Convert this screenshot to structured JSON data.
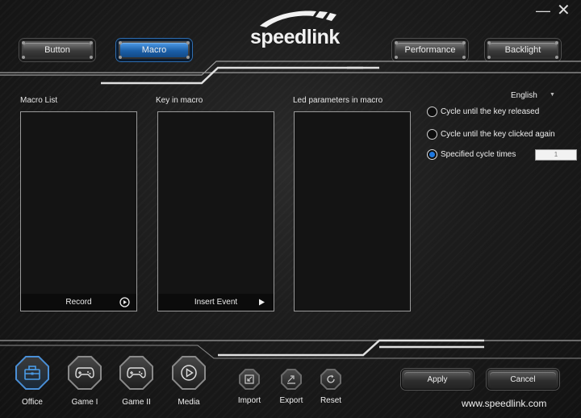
{
  "window": {
    "minimize_glyph": "—",
    "close_glyph": "✕"
  },
  "brand": {
    "logo_text": "speedlink",
    "website": "www.speedlink.com"
  },
  "tabs": [
    {
      "label": "Button",
      "active": false
    },
    {
      "label": "Macro",
      "active": true
    },
    {
      "label": "Performance",
      "active": false
    },
    {
      "label": "Backlight",
      "active": false
    }
  ],
  "macro": {
    "macro_list_title": "Macro List",
    "key_in_macro_title": "Key in macro",
    "led_params_title": "Led parameters in macro",
    "record_label": "Record",
    "insert_event_label": "Insert Event"
  },
  "options": {
    "language": "English",
    "cycle_options": [
      {
        "label": "Cycle until the key released",
        "checked": false
      },
      {
        "label": "Cycle until the key clicked again",
        "checked": false
      },
      {
        "label": "Specified cycle times",
        "checked": true
      }
    ],
    "cycle_times_value": "1"
  },
  "profiles": [
    {
      "label": "Office",
      "icon": "briefcase-icon",
      "active": true
    },
    {
      "label": "Game I",
      "icon": "gamepad-icon",
      "active": false
    },
    {
      "label": "Game II",
      "icon": "gamepad-icon",
      "active": false
    },
    {
      "label": "Media",
      "icon": "play-circle-icon",
      "active": false
    }
  ],
  "tools": [
    {
      "label": "Import",
      "icon": "import-icon"
    },
    {
      "label": "Export",
      "icon": "export-icon"
    },
    {
      "label": "Reset",
      "icon": "reset-icon"
    }
  ],
  "actions": {
    "apply_label": "Apply",
    "cancel_label": "Cancel"
  },
  "colors": {
    "accent_blue": "#1e78e0",
    "background": "#1c1c1c",
    "panel": "#141414"
  }
}
